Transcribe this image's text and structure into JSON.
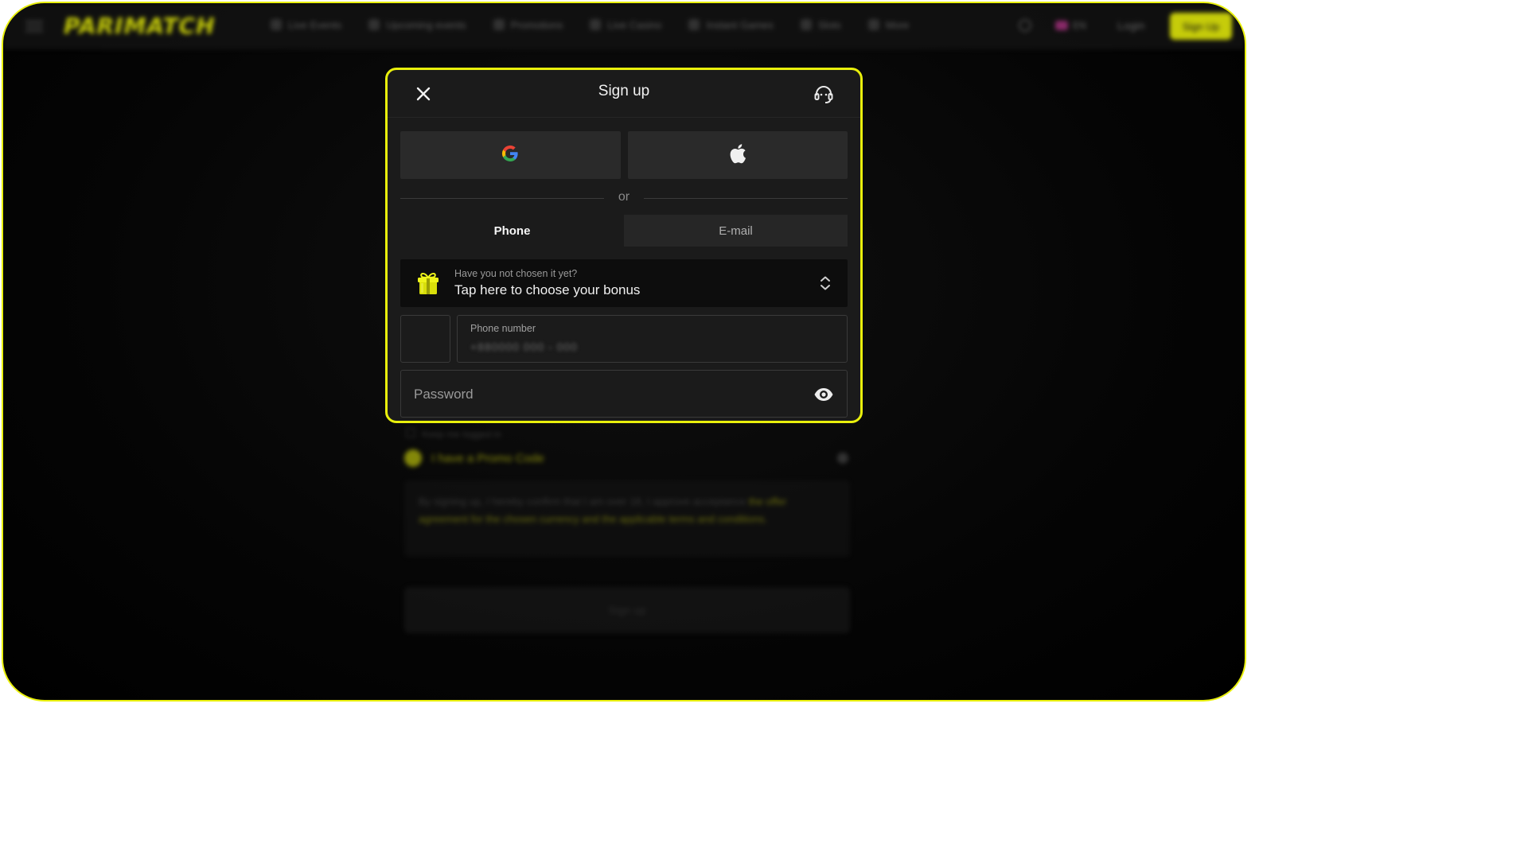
{
  "app": {
    "brand": "PARIMATCH",
    "accent_color": "#e9f00c",
    "background_color": "#050505"
  },
  "header": {
    "nav_items": [
      "Live Events",
      "Upcoming events",
      "Promotions",
      "Live Casino",
      "Instant Games",
      "Slots",
      "More"
    ],
    "language": "EN",
    "login_label": "Login",
    "signup_label": "Sign Up"
  },
  "modal": {
    "title": "Sign up",
    "close_icon": "close-icon",
    "support_icon": "headset-support-icon",
    "social": {
      "google_icon": "google-logo-icon",
      "apple_icon": "apple-logo-icon"
    },
    "divider_text": "or",
    "tabs": [
      {
        "label": "Phone",
        "active": true
      },
      {
        "label": "E-mail",
        "active": false
      }
    ],
    "bonus": {
      "icon": "gift-icon",
      "hint": "Have you not chosen it yet?",
      "cta": "Tap here to choose your bonus",
      "toggle_icon": "chevron-up-down-icon"
    },
    "phone": {
      "label": "Phone number",
      "value": "+880000 000 - 000"
    },
    "password": {
      "placeholder": "Password",
      "value": "",
      "visibility_icon": "eye-icon"
    }
  },
  "background_form": {
    "remember_label": "Keep me logged in",
    "promo_label": "I have a Promo Code",
    "terms_text": "By signing up, I hereby confirm that I am over 18, I approve acceptance",
    "terms_link": "the offer agreement for the chosen currency and the applicable terms and conditions.",
    "submit_label": "Sign up"
  }
}
